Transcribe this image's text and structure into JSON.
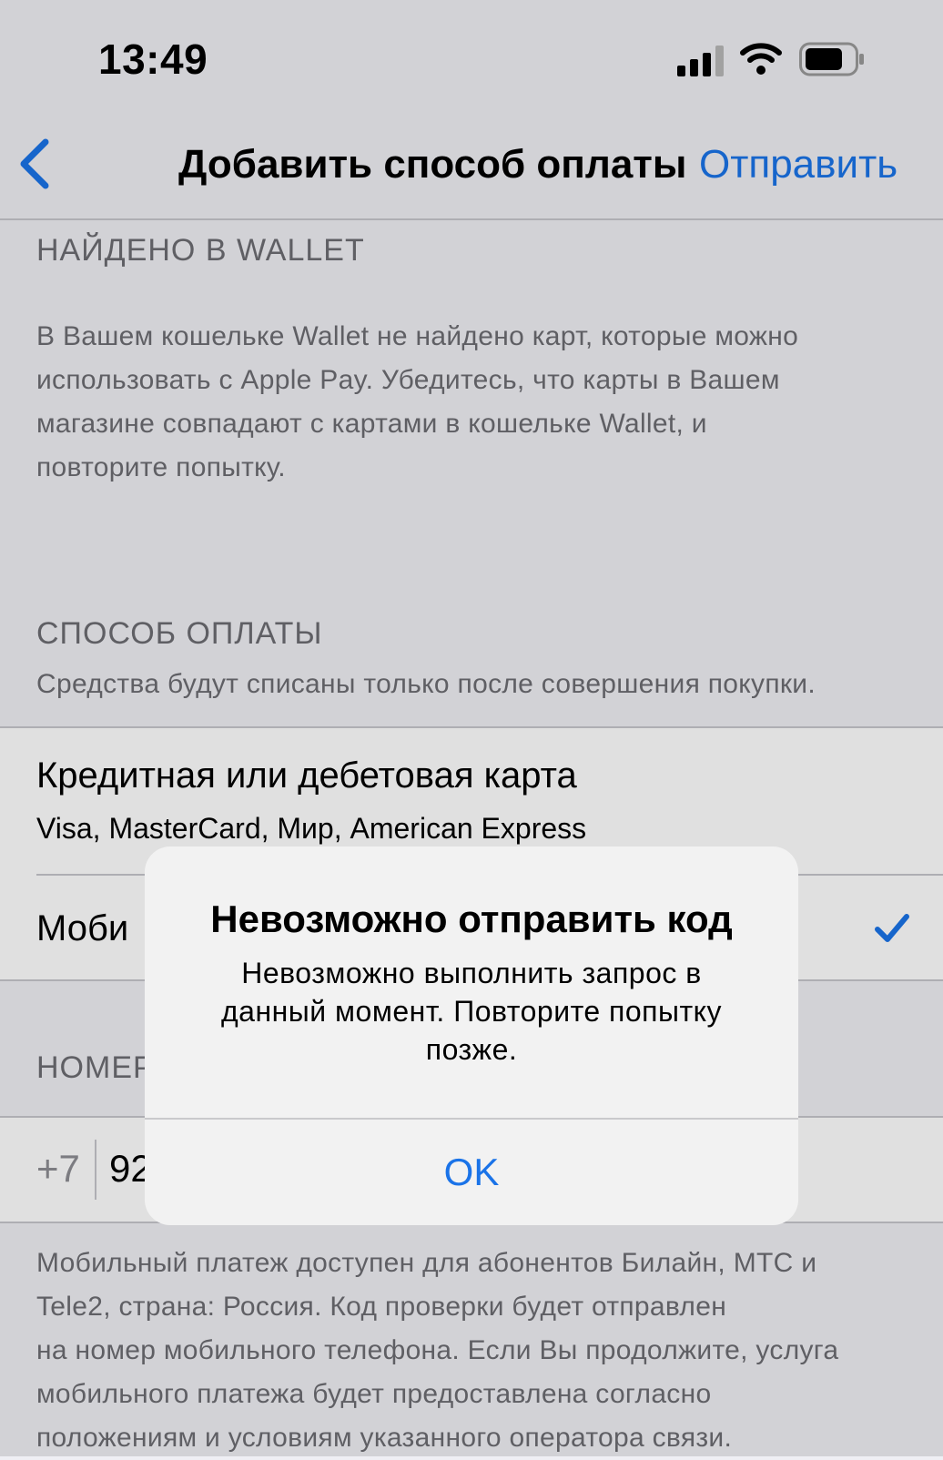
{
  "status_bar": {
    "time": "13:49"
  },
  "nav": {
    "title": "Добавить способ оплаты",
    "action": "Отправить"
  },
  "wallet_section": {
    "header": "НАЙДЕНО В WALLET",
    "lines": [
      "В Вашем кошельке Wallet не найдено карт, которые можно",
      "использовать с Apple Pay. Убедитесь, что карты в Вашем",
      "магазине совпадают с картами в кошельке Wallet, и",
      "повторите попытку."
    ]
  },
  "payment_section": {
    "header": "СПОСОБ ОПЛАТЫ",
    "note": "Средства будут списаны только после совершения покупки.",
    "options": [
      {
        "title": "Кредитная или дебетовая карта",
        "subtitle": "Visa, MasterCard, Мир, American Express"
      },
      {
        "title": "Моби"
      }
    ]
  },
  "number_section": {
    "header": "НОМЕР",
    "code": "+7",
    "number": "92"
  },
  "footer_lines": [
    "Мобильный платеж доступен для абонентов Билайн, МТС и",
    "Tele2, страна: Россия. Код проверки будет отправлен",
    "на номер мобильного телефона. Если Вы продолжите, услуга",
    "мобильного платежа будет предоставлена согласно",
    "положениям и условиям указанного оператора связи."
  ],
  "alert": {
    "title": "Невозможно отправить код",
    "message_lines": [
      "Невозможно выполнить запрос в",
      "данный момент. Повторите попытку",
      "позже."
    ],
    "ok_label": "OK"
  },
  "colors": {
    "accent": "#1a73e8",
    "background": "#efeff4",
    "secondary_text": "#6d6d72"
  },
  "icons": [
    "signal-icon",
    "wifi-icon",
    "battery-icon",
    "back-chevron-icon",
    "checkmark-icon"
  ]
}
